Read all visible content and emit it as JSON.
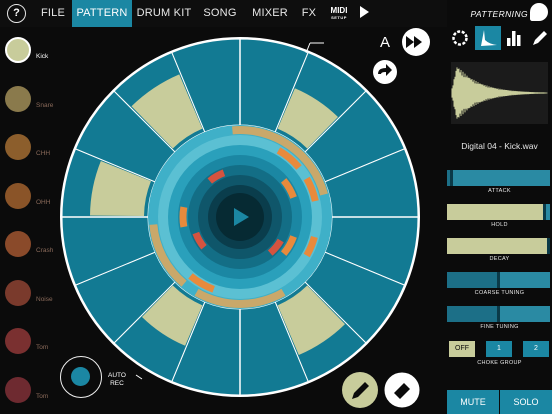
{
  "topbar": {
    "help": "?",
    "menu": [
      {
        "label": "FILE",
        "active": false
      },
      {
        "label": "PATTERN",
        "active": true
      },
      {
        "label": "DRUM KIT",
        "active": false
      },
      {
        "label": "SONG",
        "active": false
      },
      {
        "label": "MIXER",
        "active": false
      },
      {
        "label": "FX",
        "active": false
      }
    ],
    "midi_label": "MIDI",
    "midi_sub": "SETUP"
  },
  "brand": "PATTERNING",
  "tracks": [
    {
      "label": "Kick",
      "color": "#c8cc9b",
      "active": true
    },
    {
      "label": "Snare",
      "color": "#8a7a4c",
      "active": false
    },
    {
      "label": "CHH",
      "color": "#8c5e2c",
      "active": false
    },
    {
      "label": "OHH",
      "color": "#8a5428",
      "active": false
    },
    {
      "label": "Crash",
      "color": "#8a4a2a",
      "active": false
    },
    {
      "label": "Noise",
      "color": "#7a3a2c",
      "active": false
    },
    {
      "label": "Tom",
      "color": "#7a3030",
      "active": false
    },
    {
      "label": "Tom",
      "color": "#6e2a30",
      "active": false
    }
  ],
  "pattern": {
    "name": "A",
    "steps_active": [
      false,
      true,
      false,
      false,
      false,
      false,
      true,
      false,
      false,
      true,
      false,
      false,
      true,
      false,
      true,
      false
    ]
  },
  "colors": {
    "accent": "#1b87a3",
    "active_step": "#c8cc9b",
    "inactive_step": "#127a93",
    "orange": "#e88a3c",
    "red": "#d5533f"
  },
  "right": {
    "sample_name": "Digital 04 - Kick.wav",
    "sliders": [
      {
        "label": "ATTACK",
        "value": 0.04,
        "style": "blue"
      },
      {
        "label": "HOLD",
        "value": 0.95,
        "style": "tan"
      },
      {
        "label": "DECAY",
        "value": 0.99,
        "style": "tan"
      },
      {
        "label": "COARSE TUNING",
        "value": 0.5,
        "style": "blue"
      },
      {
        "label": "FINE TUNING",
        "value": 0.5,
        "style": "blue"
      }
    ],
    "choke_label": "CHOKE GROUP",
    "choke_options": [
      "OFF",
      "1",
      "2"
    ],
    "choke_selected": "OFF",
    "mute": "MUTE",
    "solo": "SOLO"
  },
  "auto_rec": {
    "line1": "AUTO",
    "line2": "REC"
  }
}
